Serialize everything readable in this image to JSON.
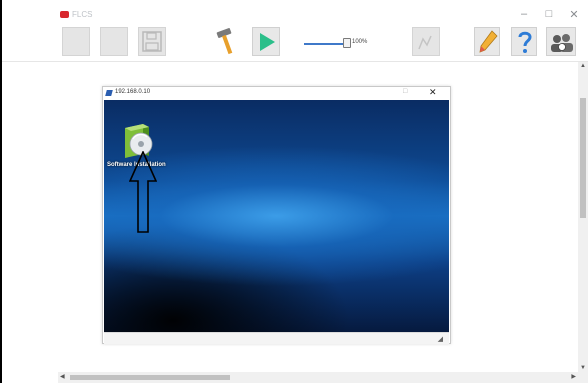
{
  "app": {
    "title": "FLCS",
    "window_controls": [
      "–",
      "□",
      "✕"
    ]
  },
  "toolbar": {
    "zoom_label": "100%",
    "zoom_value": 1.0
  },
  "remote_window": {
    "title": "192.168.0.10",
    "max_glyph": "□",
    "close_glyph": "✕"
  },
  "desktop": {
    "icon_label": "Software Installation"
  },
  "colors": {
    "accent": "#3f79c9",
    "play": "#2bbf8a",
    "logo": "#d8282e"
  }
}
